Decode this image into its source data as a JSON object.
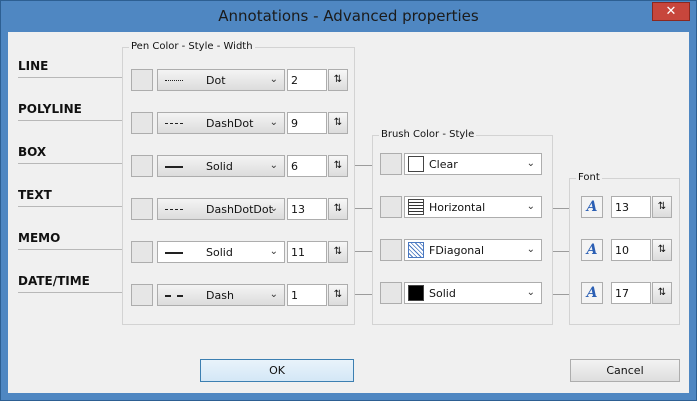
{
  "window": {
    "title": "Annotations - Advanced properties",
    "close_label": "✕"
  },
  "rows": [
    {
      "label": "LINE",
      "pen_style": "Dot",
      "width": "2"
    },
    {
      "label": "POLYLINE",
      "pen_style": "DashDot",
      "width": "9"
    },
    {
      "label": "BOX",
      "pen_style": "Solid",
      "width": "6"
    },
    {
      "label": "TEXT",
      "pen_style": "DashDotDot",
      "width": "13"
    },
    {
      "label": "MEMO",
      "pen_style": "Solid",
      "width": "11"
    },
    {
      "label": "DATE/TIME",
      "pen_style": "Dash",
      "width": "1"
    }
  ],
  "groups": {
    "pen": "Pen Color - Style - Width",
    "brush": "Brush Color - Style",
    "font": "Font"
  },
  "brush": [
    {
      "style": "Clear",
      "icon": "clear-icon"
    },
    {
      "style": "Horizontal",
      "icon": "horizontal-lines-icon"
    },
    {
      "style": "FDiagonal",
      "icon": "diagonal-lines-icon"
    },
    {
      "style": "Solid",
      "icon": "solid-fill-icon"
    }
  ],
  "fonts": [
    {
      "glyph": "A",
      "size": "13"
    },
    {
      "glyph": "A",
      "size": "10"
    },
    {
      "glyph": "A",
      "size": "17"
    }
  ],
  "spin_glyph": "⇅",
  "arrow_glyph": "⌄",
  "buttons": {
    "ok": "OK",
    "cancel": "Cancel"
  },
  "colors": {
    "title_bar": "#4f87c2",
    "client": "#f0f0f0",
    "font_icon": "#2b5fb4"
  }
}
